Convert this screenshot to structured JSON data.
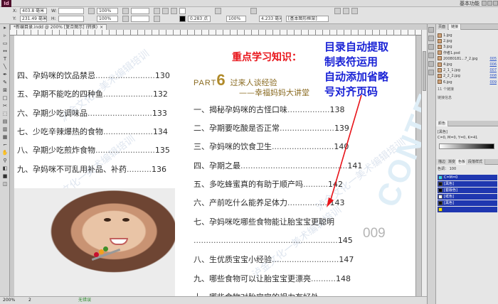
{
  "app": {
    "logo": "Id",
    "workspace": "基本功能"
  },
  "control": {
    "x_label": "X:",
    "x_value": "403.8 毫米",
    "y_label": "Y:",
    "y_value": "231.49 毫米",
    "w_label": "W:",
    "h_label": "H:",
    "zoom": "100%",
    "stroke": "0.283 点",
    "spacing": "4.233 毫米",
    "style": "[基本图形框架]"
  },
  "document": {
    "tab_label": "*新编目录.indd @ 200% [复合图示] (转换)",
    "close": "×"
  },
  "status": {
    "page": "2",
    "zoom": "200%",
    "state": "无错误"
  },
  "toc_left": [
    {
      "text": "四、孕妈咪的饮品禁忌",
      "dots": "........................",
      "page": "130"
    },
    {
      "text": "五、孕期不能吃的四种鱼",
      "dots": "....................",
      "page": "132"
    },
    {
      "text": "六、孕期少吃调味品",
      "dots": "..........................",
      "page": "133"
    },
    {
      "text": "七、少吃辛辣爆热的食物",
      "dots": "....................",
      "page": "134"
    },
    {
      "text": "八、孕期少吃煎炸食物",
      "dots": "........................",
      "page": "135"
    },
    {
      "text": "九、孕妈咪不可乱用补品、补药",
      "dots": "..........",
      "page": "136"
    }
  ],
  "part": {
    "word": "PART",
    "number": "6",
    "title": "过来人谈经验",
    "subtitle": "——幸福妈妈大讲堂"
  },
  "toc_right": [
    {
      "text": "一、揭秘孕妈咪的古怪口味",
      "dots": ".................",
      "page": "138"
    },
    {
      "text": "二、孕期要吃酸是否正常",
      "dots": "......................",
      "page": "139"
    },
    {
      "text": "三、孕妈咪的饮食卫生",
      "dots": ".........................",
      "page": "140"
    },
    {
      "text": "四、孕期之最",
      "dots": "...........................................",
      "page": "141"
    },
    {
      "text": "五、多吃蜂蜜真的有助于顺产吗",
      "dots": "..........",
      "page": "142"
    },
    {
      "text": "六、产前吃什么能养足体力",
      "dots": ".................",
      "page": "143"
    }
  ],
  "toc_right_wrapped": {
    "text": "七、孕妈咪吃哪些食物能让胎宝宝更聪明",
    "dots": "..........................................................",
    "page": "145"
  },
  "toc_right_more": [
    {
      "text": "八、生优质宝宝小经验",
      "dots": "...........................",
      "page": "147"
    },
    {
      "text": "九、哪些食物可以让胎宝宝更漂亮",
      "dots": "..........",
      "page": "148"
    },
    {
      "text": "十、哪些食物对胎宝宝的视力有好处",
      "dots": ".........",
      "page": ""
    }
  ],
  "decor": {
    "contents": "CONTENTS",
    "page_number": "009",
    "watermark": "泸金文化一美术编辑培训"
  },
  "notes": {
    "red": "重点学习知识：",
    "blue": [
      "目录自动提取",
      "制表符运用",
      "自动添加省略",
      "号对齐页码"
    ],
    "arrow_color": "#e8141a"
  },
  "panels": {
    "links_tabs": [
      "页面",
      "链接"
    ],
    "links": [
      {
        "name": "1.jpg",
        "num": ""
      },
      {
        "name": "2.jpg",
        "num": ""
      },
      {
        "name": "3.jpg",
        "num": ""
      },
      {
        "name": "作者1.psd",
        "num": ""
      },
      {
        "name": "20080181...7_2.jpg",
        "num": "005"
      },
      {
        "name": "4.jpg",
        "num": "006"
      },
      {
        "name": "2_1_1.jpg",
        "num": "007"
      },
      {
        "name": "2_2_2.jpg",
        "num": "008"
      },
      {
        "name": "6.jpg",
        "num": "009"
      }
    ],
    "links_footer": "11 个链接",
    "link_info_label": "链接信息",
    "color_tab": "颜色",
    "color_name": "[黑色]",
    "color_value": "C=0, M=0, Y=0, K=41",
    "swatch_tabs": [
      "描边",
      "渐变",
      "色板",
      "段落样式"
    ],
    "tint_label": "色调：",
    "tint_value": "100",
    "swatches": [
      {
        "name": "C=M=0",
        "color": "#2dd4f5"
      },
      {
        "name": "[黑色]",
        "color": "#111111"
      },
      {
        "name": "[套版色]",
        "color": "#000000"
      },
      {
        "name": "[纸色]",
        "color": "#ffffff"
      },
      {
        "name": "[黑色]",
        "color": "#111111"
      },
      {
        "name": "",
        "color": "#f5e400"
      }
    ]
  }
}
